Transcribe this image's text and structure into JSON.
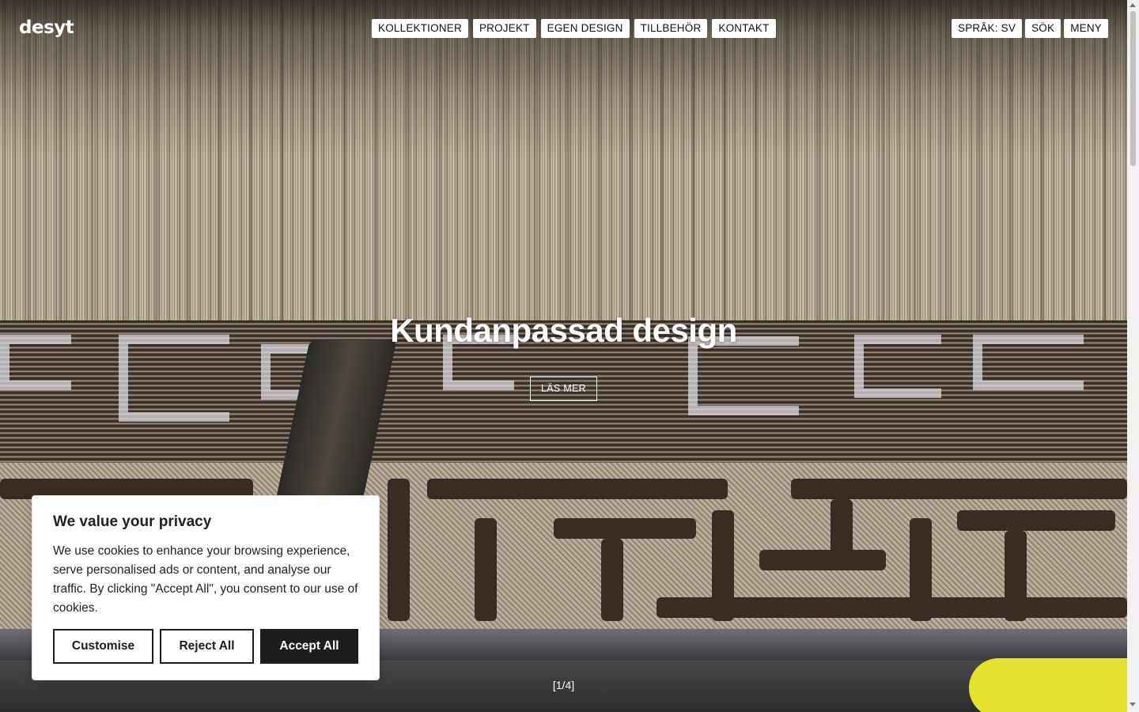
{
  "brand": {
    "logo_text": "desyt"
  },
  "nav": {
    "items": [
      {
        "label": "KOLLEKTIONER"
      },
      {
        "label": "PROJEKT"
      },
      {
        "label": "EGEN DESIGN"
      },
      {
        "label": "TILLBEHÖR"
      },
      {
        "label": "KONTAKT"
      }
    ],
    "language_label": "SPRÅK: SV",
    "search_label": "SÖK",
    "menu_label": "MENY"
  },
  "hero": {
    "title": "Kundanpassad design",
    "cta_label": "LÄS MER",
    "slide_counter": "[1/4]"
  },
  "cookie_banner": {
    "title": "We value your privacy",
    "text": "We use cookies to enhance your browsing experience, serve personalised ads or content, and analyse our traffic. By clicking \"Accept All\", you consent to our use of cookies.",
    "customise_label": "Customise",
    "reject_label": "Reject All",
    "accept_label": "Accept All"
  },
  "colors": {
    "pill_bg": "#ffffff",
    "text_dark": "#212121",
    "accept_bg": "#1d1d1d"
  }
}
